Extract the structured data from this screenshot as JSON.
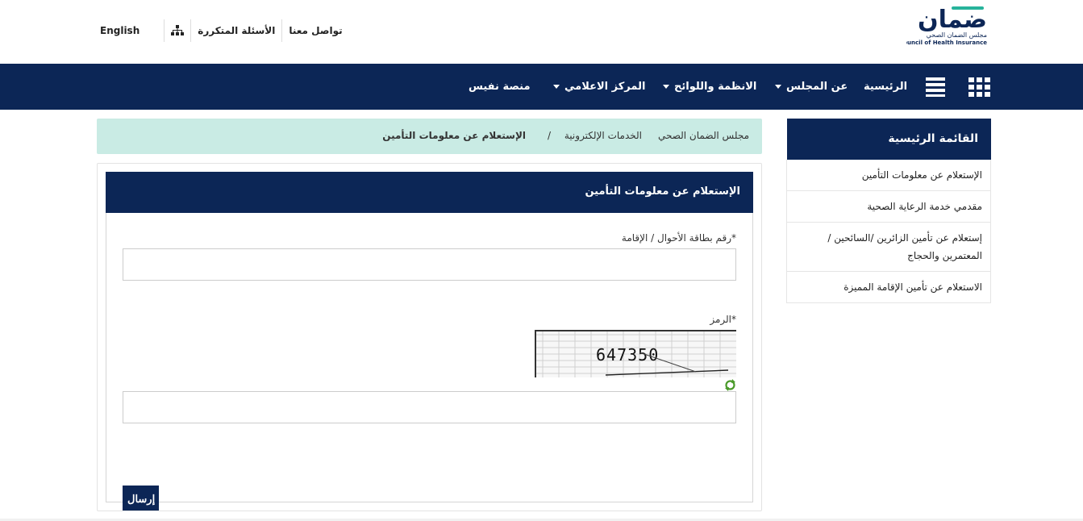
{
  "top_links": {
    "english": "English",
    "faq": "الأسئلة المتكررة",
    "contact": "تواصل معنا"
  },
  "logo": {
    "arabic_name": "ضمان",
    "arabic_sub": "مجلس الضمان الصحي",
    "english_sub": "Council of Health Insurance",
    "brand_teal": "#27b39b",
    "brand_navy": "#0c2656"
  },
  "nav": {
    "items": [
      "منصة نفيس",
      "المركز الاعلامي",
      "الانظمة واللوائح",
      "عن المجلس",
      "الرئيسية"
    ],
    "icons": [
      "grid-icon",
      "menu-icon"
    ]
  },
  "sidebar": {
    "title": "القائمة الرئيسية",
    "items": [
      "الإستعلام عن معلومات التأمين",
      "مقدمي خدمة الرعاية الصحية",
      "إستعلام عن تأمين الزائرين /السائحين / المعتمرين والحجاج",
      "الاستعلام عن تأمين الإقامة المميزة"
    ]
  },
  "breadcrumb": {
    "home": "مجلس الضمان الصحي",
    "services": "الخدمات الإلكترونية",
    "separator": "/",
    "current": "الإستعلام عن معلومات التأمين"
  },
  "form": {
    "title": "الإستعلام عن معلومات التأمين",
    "id_label": "رقم بطاقة الأحوال / الإقامة*",
    "id_value": "",
    "captcha_label": "الرمز*",
    "captcha_text": "647350",
    "captcha_value": "",
    "submit": "إرسال"
  },
  "colors": {
    "navy": "#0c2656",
    "breadcrumb_bg": "#c9ebe4"
  }
}
